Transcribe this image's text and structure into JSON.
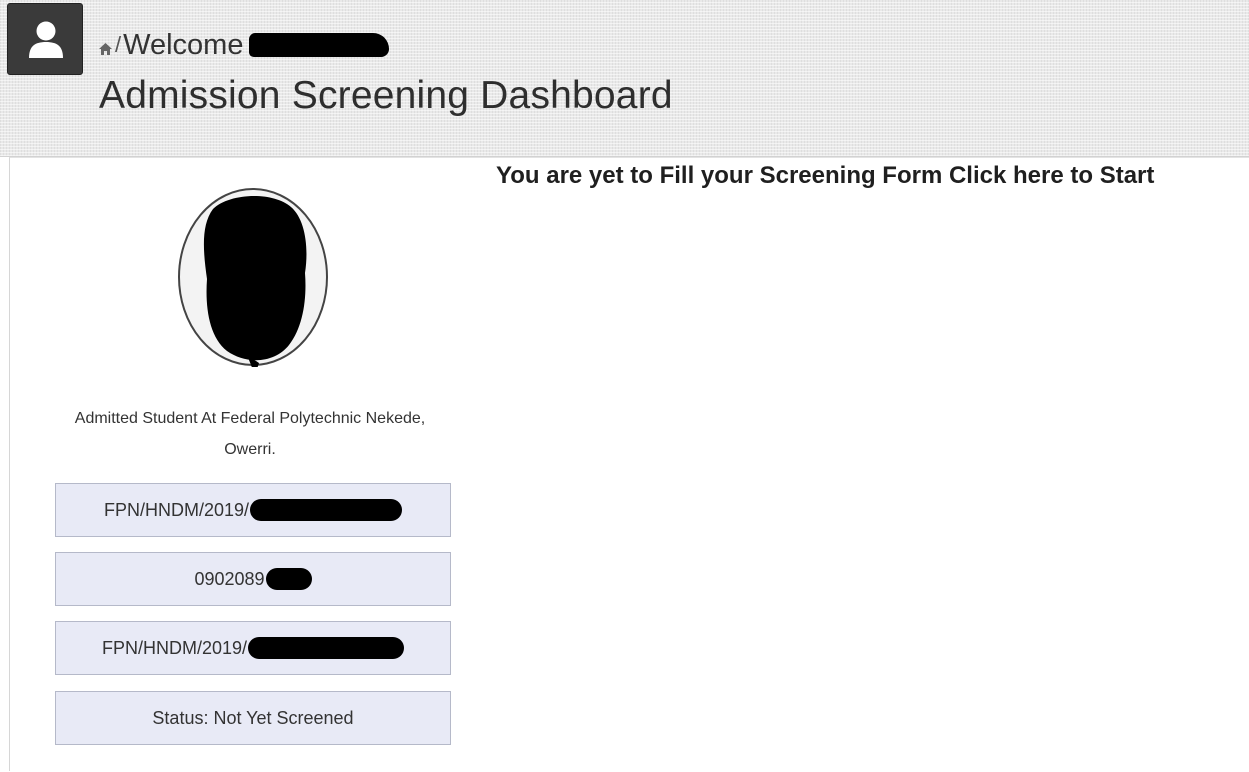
{
  "header": {
    "breadcrumb_separator": "/",
    "welcome_text": "Welcome",
    "title": "Admission Screening Dashboard"
  },
  "profile": {
    "caption": "Admitted Student At Federal Polytechnic Nekede, Owerri.",
    "reg_number": "FPN/HNDM/2019/",
    "phone": "0902089",
    "application_number": "FPN/HNDM/2019/",
    "status": "Status: Not Yet Screened"
  },
  "main": {
    "screening_prompt": "You are yet to Fill your Screening Form Click here to Start"
  },
  "icons": {
    "avatar": "user-icon",
    "home": "home-icon"
  },
  "colors": {
    "avatar_bg": "#3a3a3a",
    "info_box_bg": "#e8eaf6",
    "info_box_border": "#b5b9c9",
    "redaction": "#000000"
  }
}
